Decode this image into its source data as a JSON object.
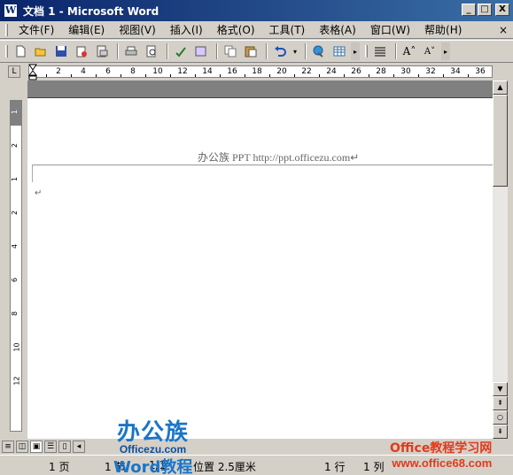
{
  "app": {
    "title": "文档 1 - Microsoft Word",
    "icon_letter": "W"
  },
  "window_buttons": {
    "minimize": "_",
    "maximize": "□",
    "close": "X"
  },
  "menu": {
    "items": [
      {
        "label": "文件(F)"
      },
      {
        "label": "编辑(E)"
      },
      {
        "label": "视图(V)"
      },
      {
        "label": "插入(I)"
      },
      {
        "label": "格式(O)"
      },
      {
        "label": "工具(T)"
      },
      {
        "label": "表格(A)"
      },
      {
        "label": "窗口(W)"
      },
      {
        "label": "帮助(H)"
      }
    ],
    "close_glyph": "×"
  },
  "toolbar": {
    "icons": [
      "new-icon",
      "open-icon",
      "save-icon",
      "permission-icon",
      "email-icon",
      "print-icon",
      "print-preview-icon",
      "spelling-icon",
      "research-icon",
      "copy-icon",
      "paste-icon",
      "undo-icon",
      "hyperlink-icon",
      "table-icon",
      "align-icon",
      "grow-font-icon",
      "shrink-font-icon"
    ],
    "grow_font": "A˄",
    "shrink_font": "A˅"
  },
  "ruler": {
    "corner": "L",
    "numbers": [
      "2",
      "4",
      "6",
      "8",
      "10",
      "12",
      "14",
      "16",
      "18",
      "20",
      "22",
      "24",
      "26",
      "28",
      "30",
      "32",
      "34",
      "36"
    ],
    "v_numbers": [
      "1",
      "2",
      "1",
      "2",
      "4",
      "6",
      "8",
      "10",
      "12"
    ]
  },
  "document": {
    "header_text": "办公族 PPT    http://ppt.officezu.com",
    "paragraph_mark": "↵",
    "header_mark": "↵"
  },
  "status": {
    "page": "1 页",
    "section": "1 节",
    "pages": "1/1",
    "position": "位置 2.5厘米",
    "line": "1 行",
    "col": "1 列"
  },
  "watermarks": {
    "logo": "办公族",
    "logo_sub": "Officezu.com",
    "word_text": "Word教程",
    "right_title": "Office教程学习网",
    "right_url": "www.office68.com"
  },
  "colors": {
    "titlebar_start": "#0a246a",
    "titlebar_end": "#3a6ea5",
    "chrome": "#d4d0c8",
    "watermark_blue": "#1a75c9",
    "watermark_red": "#e03a1c"
  }
}
